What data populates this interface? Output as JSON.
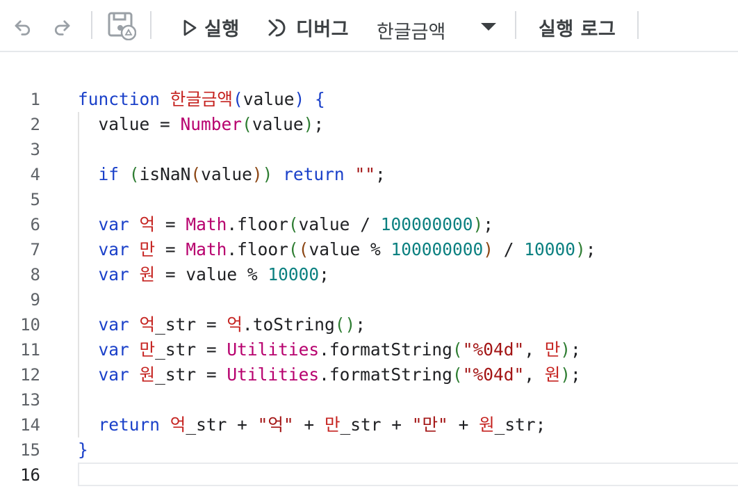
{
  "toolbar": {
    "undo_icon": "undo-icon",
    "redo_icon": "redo-icon",
    "save_icon": "save-drive-icon",
    "run_icon": "play-icon",
    "run_label": "실행",
    "debug_icon": "debug-icon",
    "debug_label": "디버그",
    "function_select": {
      "selected": "한글금액",
      "icon": "caret-down-icon"
    },
    "log_label": "실행 로그"
  },
  "editor": {
    "active_line": 16,
    "line_numbers": [
      "1",
      "2",
      "3",
      "4",
      "5",
      "6",
      "7",
      "8",
      "9",
      "10",
      "11",
      "12",
      "13",
      "14",
      "15",
      "16"
    ],
    "tokens": {
      "function": "function",
      "fn_name": "한글금액",
      "value": "value",
      "number_fn": "Number",
      "if": "if",
      "isnan": "isNaN",
      "return": "return",
      "empty_str": "\"\"",
      "var": "var",
      "eok": "억",
      "man": "만",
      "won": "원",
      "math": "Math",
      "floor": "floor",
      "n_1e8": "100000000",
      "n_1e4": "10000",
      "str_suffix": "_str",
      "to_string": "toString",
      "utilities": "Utilities",
      "format_string": "formatString",
      "fmt": "\"%04d\"",
      "eok_str_lit": "\"억\"",
      "man_str_lit": "\"만\""
    }
  }
}
